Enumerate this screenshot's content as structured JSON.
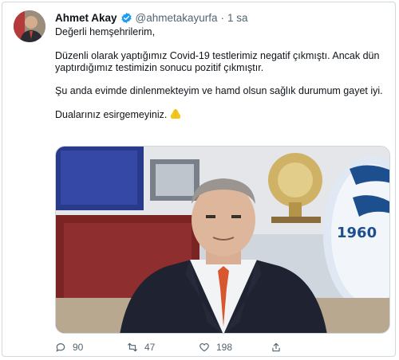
{
  "tweet": {
    "author_name": "Ahmet Akay",
    "handle": "@ahmetakayurfa",
    "separator": "·",
    "time": "1 sa",
    "paragraphs": [
      "Değerli hemşehrilerim,",
      "Düzenli olarak yaptığımız Covid-19 testlerimiz negatif çıkmıştı. Ancak dün yaptırdığımız testimizin sonucu pozitif çıkmıştır.",
      "Şu anda evimde dinlenmekteyim ve hamd olsun sağlık durumum gayet iyi.",
      "Dualarınız esirgemeyiniz."
    ],
    "emoji": "praying-hands-icon",
    "colors": {
      "verified": "#1d9bf0",
      "muted": "#536471",
      "emoji": "#f5c518"
    }
  },
  "photo": {
    "plaque_text": "1960"
  },
  "actions": {
    "reply_count": "90",
    "retweet_count": "47",
    "like_count": "198"
  }
}
